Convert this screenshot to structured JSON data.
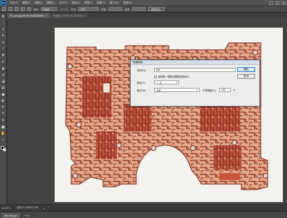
{
  "app": {
    "logo": "Ps"
  },
  "menu": [
    "文件(F)",
    "编辑(E)",
    "图像(I)",
    "图层(L)",
    "文字(Y)",
    "选择(S)",
    "滤镜(T)",
    "视图(V)",
    "窗口(W)",
    "帮助(H)"
  ],
  "window_controls": {
    "minimize": "–",
    "maximize": "□",
    "close": "×"
  },
  "options_bar": {
    "feather_label": "羽化:",
    "feather_value": "0 像素",
    "antialias_label": "消除锯齿",
    "style_label": "样式:",
    "style_value": "正常",
    "width_label": "宽度:",
    "height_label": "高度:",
    "refine_button": "调整边缘..."
  },
  "tabs": [
    {
      "label": "75_pcb.jpg @ 16.7%(RGB/8#)",
      "close": "×"
    },
    {
      "label": "未标题-1 @ 66.7% (RGB/8)",
      "close": "×"
    }
  ],
  "tools": [
    {
      "name": "move-tool-icon",
      "glyph": "✥"
    },
    {
      "name": "marquee-tool-icon",
      "glyph": "⬚"
    },
    {
      "name": "lasso-tool-icon",
      "glyph": "ℓ"
    },
    {
      "name": "quick-select-tool-icon",
      "glyph": "✎"
    },
    {
      "name": "crop-tool-icon",
      "glyph": "⌗"
    },
    {
      "name": "eyedropper-tool-icon",
      "glyph": "⁄"
    },
    {
      "name": "healing-brush-icon",
      "glyph": "✚"
    },
    {
      "name": "brush-tool-icon",
      "glyph": "✐"
    },
    {
      "name": "clone-stamp-icon",
      "glyph": "▲"
    },
    {
      "name": "history-brush-icon",
      "glyph": "↺"
    },
    {
      "name": "eraser-tool-icon",
      "glyph": "◪"
    },
    {
      "name": "gradient-tool-icon",
      "glyph": "▤"
    },
    {
      "name": "blur-tool-icon",
      "glyph": "●"
    },
    {
      "name": "dodge-tool-icon",
      "glyph": "◐"
    },
    {
      "name": "pen-tool-icon",
      "glyph": "✒"
    },
    {
      "name": "type-tool-icon",
      "glyph": "T"
    },
    {
      "name": "path-select-tool-icon",
      "glyph": "➤"
    },
    {
      "name": "shape-tool-icon",
      "glyph": "■"
    },
    {
      "name": "hand-tool-icon",
      "glyph": "✋"
    },
    {
      "name": "zoom-tool-icon",
      "glyph": "⌕"
    }
  ],
  "dialog": {
    "title": "新建图层",
    "name_label": "名称(N):",
    "name_value": "bai",
    "clip_label": "使用前一图层创建剪贴蒙版(P)",
    "color_label": "颜色(C):",
    "color_value": "无",
    "mode_label": "模式(M):",
    "mode_value": "正常",
    "opacity_label": "不透明度(O):",
    "opacity_value": "100",
    "opacity_unit": "%",
    "ok_button": "确定",
    "cancel_button": "取消"
  },
  "status": {
    "zoom": "16.67%",
    "doc": "文档:52.5M/52.5M",
    "arrow": "▸"
  },
  "bottom_tabs": [
    "Mini Bridge",
    "时间轴"
  ],
  "colors": {
    "pcb_board": "#e3a98a",
    "pcb_trace": "#8b2a1c",
    "paper": "#f3f2ef"
  }
}
